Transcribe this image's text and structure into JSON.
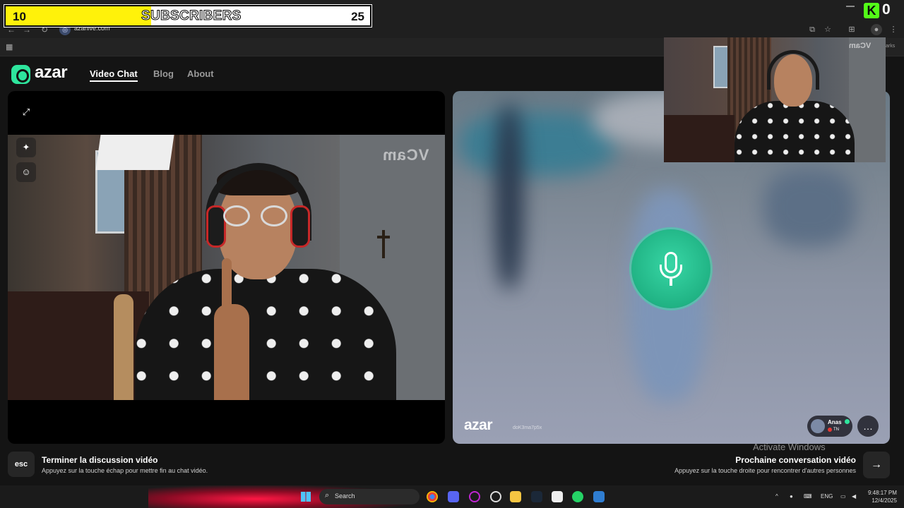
{
  "browser": {
    "address": "azarlive.com",
    "bookmarks_label": "arks"
  },
  "overlay": {
    "subscriber_count": "10",
    "subscriber_label": "SUBSCRIBERS",
    "subscriber_goal": "25",
    "progress_fraction": 0.4,
    "kick_count": "0",
    "accent_yellow": "#fff20a",
    "kick_green": "#53fc18"
  },
  "nav": {
    "logo_text": "azar",
    "links": [
      "Video Chat",
      "Blog",
      "About"
    ],
    "active": "Video Chat"
  },
  "local_video": {
    "watermark": "VCam"
  },
  "remote_video": {
    "logo_text": "azar",
    "session_id": "doK3ma7p5x",
    "user_name": "Anas",
    "user_country": "TN",
    "mic_color": "#20b384"
  },
  "bottom": {
    "esc_key": "esc",
    "end_title": "Terminer la discussion vidéo",
    "end_subtitle": "Appuyez sur la touche échap pour mettre fin au chat vidéo.",
    "next_title": "Prochaine conversation vidéo",
    "next_subtitle": "Appuyez sur la touche droite pour rencontrer d'autres personnes",
    "activate_windows": "Activate Windows"
  },
  "webcam": {
    "watermark": "VCam"
  },
  "taskbar": {
    "search_placeholder": "Search",
    "language": "ENG",
    "time": "9:48:17 PM",
    "date": "12/4/2025"
  }
}
